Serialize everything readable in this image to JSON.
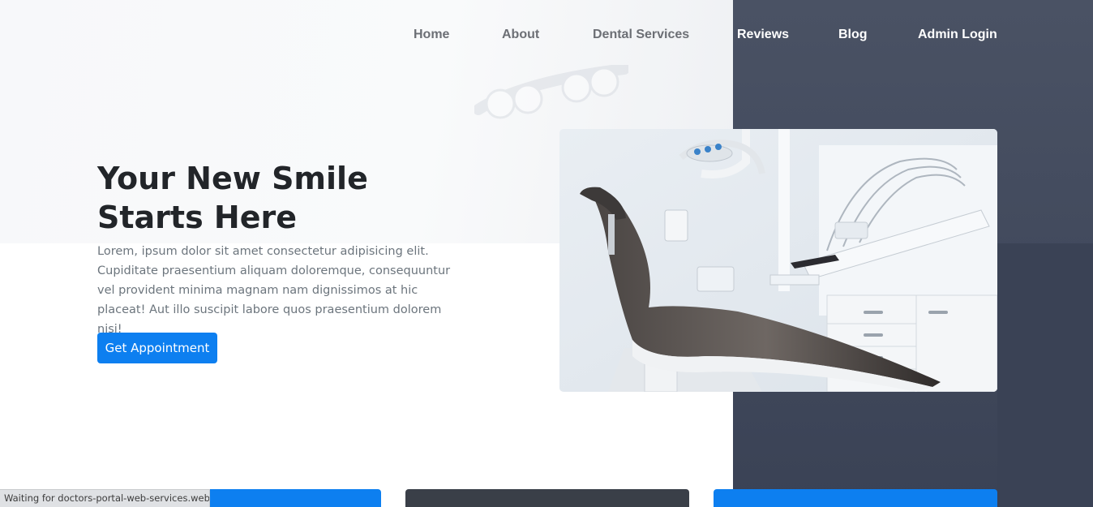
{
  "nav": {
    "items": [
      {
        "label": "Home"
      },
      {
        "label": "About"
      },
      {
        "label": "Dental Services"
      },
      {
        "label": "Reviews"
      },
      {
        "label": "Blog"
      },
      {
        "label": "Admin Login"
      }
    ]
  },
  "hero": {
    "title_line1": "Your New Smile",
    "title_line2": "Starts Here",
    "description": "Lorem, ipsum dolor sit amet consectetur adipisicing elit. Cupiditate praesentium aliquam doloremque, consequuntur vel provident minima magnam nam dignissimos at hic placeat! Aut illo suscipit labore quos praesentium dolorem nisi!",
    "cta_label": "Get Appointment",
    "image_icon": "dental-chair-photo"
  },
  "colors": {
    "primary": "#0d7ff0",
    "dark_panel": "#434b5e",
    "card_dark": "#3a3f48",
    "title": "#222529",
    "body_text": "#6c757d"
  },
  "status": {
    "text": "Waiting for doctors-portal-web-services.web...."
  }
}
